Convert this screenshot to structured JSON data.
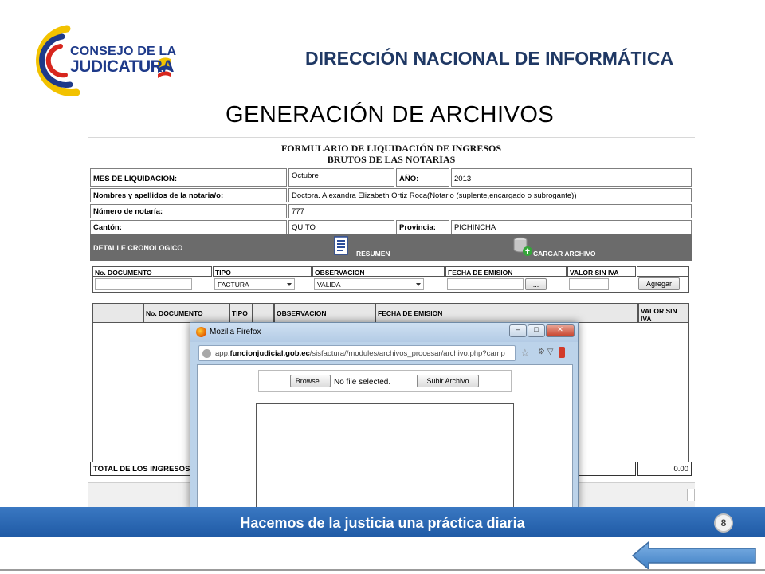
{
  "header": {
    "logo_line1": "CONSEJO DE LA",
    "logo_line2": "JUDICATURA",
    "department": "DIRECCIÓN NACIONAL DE INFORMÁTICA",
    "slide_title": "GENERACIÓN DE ARCHIVOS"
  },
  "form": {
    "title_line1": "FORMULARIO DE LIQUIDACIÓN DE INGRESOS",
    "title_line2": "BRUTOS DE LAS NOTARÍAS",
    "fields": {
      "mes_label": "MES DE LIQUIDACION:",
      "mes_value": "Octubre",
      "anio_label": "AÑO:",
      "anio_value": "2013",
      "nombres_label": "Nombres y apellidos de la notaria/o:",
      "nombres_value": "Doctora. Alexandra Elizabeth Ortiz Roca(Notario (suplente,encargado o subrogante))",
      "numero_label": "Número de notaría:",
      "numero_value": "777",
      "canton_label": "Cantón:",
      "canton_value": "QUITO",
      "provincia_label": "Provincia:",
      "provincia_value": "PICHINCHA"
    },
    "section_bar": {
      "label": "DETALLE CRONOLOGICO",
      "resumen_link": "RESUMEN",
      "cargar_link": "CARGAR ARCHIVO"
    },
    "entry_headers": [
      "No. DOCUMENTO",
      "TIPO",
      "OBSERVACION",
      "FECHA DE EMISION",
      "VALOR SIN IVA"
    ],
    "entry_row": {
      "no_documento": "",
      "tipo_selected": "FACTURA",
      "observacion_selected": "VALIDA",
      "fecha": "",
      "date_button": "...",
      "valor": "",
      "add_button": "Agregar"
    },
    "table_headers": [
      "",
      "No. DOCUMENTO",
      "TIPO",
      "",
      "OBSERVACION",
      "FECHA DE EMISION",
      "VALOR SIN IVA"
    ],
    "total_label": "TOTAL DE LOS INGRESOS",
    "total_value": "0.00"
  },
  "popup": {
    "window_title": "Mozilla Firefox",
    "url_prefix": "app.",
    "url_domain": "funcionjudicial.gob.ec",
    "url_path": "/sisfactura//modules/archivos_procesar/archivo.php?camp",
    "browse_button": "Browse...",
    "file_status": "No file selected.",
    "submit_button": "Subir Archivo"
  },
  "footer": {
    "slogan": "Hacemos de la justicia una práctica diaria",
    "page_number": "8"
  },
  "colors": {
    "brand_blue": "#1f3864",
    "footer_blue": "#2563ae",
    "section_bar_gray": "#6b6b6b"
  }
}
